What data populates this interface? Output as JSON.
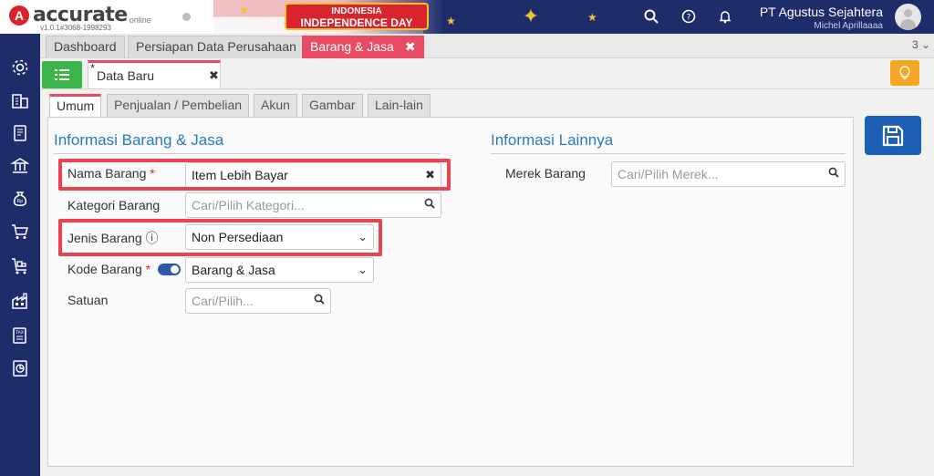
{
  "header": {
    "logo_text": "accurate",
    "logo_sub": "online",
    "version": "v1.0.1#3068-1998293",
    "banner_line1": "INDONESIA",
    "banner_line2": "INDEPENDENCE DAY",
    "company": "PT Agustus Sejahtera",
    "user": "Michel Aprillaaaa",
    "icons": [
      "search-icon",
      "help-icon",
      "bell-icon",
      "avatar"
    ]
  },
  "sidebar": {
    "icons": [
      "gear-icon",
      "company-icon",
      "ledger-icon",
      "bank-icon",
      "money-bag-icon",
      "cart-icon",
      "delivery-cart-icon",
      "factory-icon",
      "tax-icon",
      "report-icon"
    ]
  },
  "module_tabs": [
    {
      "label": "Dashboard"
    },
    {
      "label": "Persiapan Data Perusahaan"
    },
    {
      "label": "Barang & Jasa",
      "close": "✖"
    }
  ],
  "more_tabs": "3 ⌄",
  "doc_tab": {
    "star": "*",
    "label": "Data Baru",
    "close": "✖"
  },
  "sub_tabs": [
    {
      "label": "Umum"
    },
    {
      "label": "Penjualan / Pembelian"
    },
    {
      "label": "Akun"
    },
    {
      "label": "Gambar"
    },
    {
      "label": "Lain-lain"
    }
  ],
  "left_section": {
    "title": "Informasi Barang & Jasa",
    "fields": {
      "nama_barang": {
        "label": "Nama Barang",
        "required": "*",
        "value": "Item Lebih Bayar",
        "clear": "✖"
      },
      "kategori_barang": {
        "label": "Kategori Barang",
        "placeholder": "Cari/Pilih Kategori..."
      },
      "jenis_barang": {
        "label": "Jenis Barang",
        "info": "ⓘ",
        "value": "Non Persediaan"
      },
      "kode_barang": {
        "label": "Kode Barang",
        "required": "*",
        "value": "Barang & Jasa"
      },
      "satuan": {
        "label": "Satuan",
        "placeholder": "Cari/Pilih..."
      }
    }
  },
  "right_section": {
    "title": "Informasi Lainnya",
    "merek_label": "Merek Barang",
    "merek_placeholder": "Cari/Pilih Merek..."
  },
  "colors": {
    "navy": "#1f2c6a",
    "accent": "#e94b63",
    "green": "#3bb54a",
    "save_blue": "#1d5fb5",
    "highlight": "#e9444f"
  }
}
